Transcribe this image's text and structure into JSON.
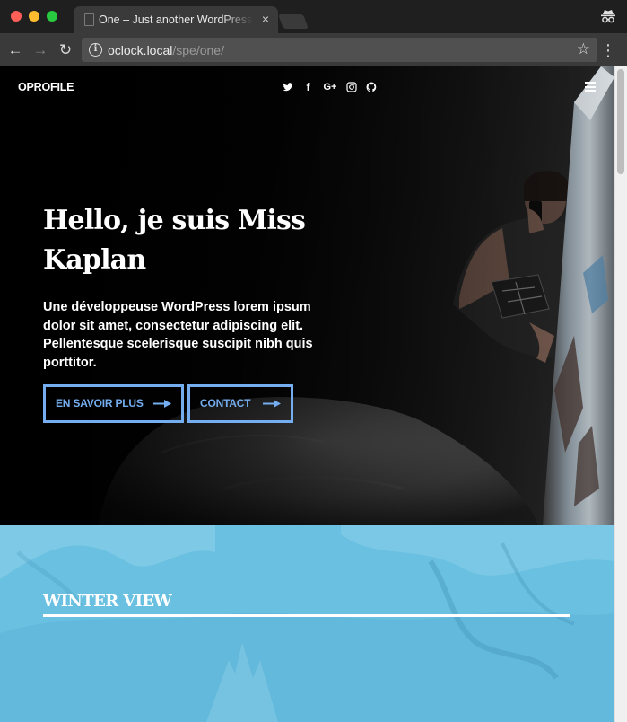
{
  "browser": {
    "tab_title": "One – Just another WordPress site",
    "tab_close": "×",
    "url_host": "oclock.local",
    "url_path": "/spe/one/",
    "info_glyph": "i",
    "back_glyph": "←",
    "forward_glyph": "→",
    "reload_glyph": "↻",
    "star_glyph": "☆",
    "menu_glyph": "⋮"
  },
  "site": {
    "logo": "OPROFILE",
    "socials": [
      {
        "name": "twitter-icon"
      },
      {
        "name": "facebook-icon",
        "glyph": "f"
      },
      {
        "name": "google-plus-icon",
        "glyph": "G+"
      },
      {
        "name": "instagram-icon"
      },
      {
        "name": "github-icon"
      }
    ]
  },
  "hero": {
    "title": "Hello, je suis Miss Kaplan",
    "text": "Une développeuse WordPress lorem ipsum dolor sit amet, consectetur adipiscing elit. Pellentesque scelerisque suscipit nibh quis porttitor.",
    "buttons": [
      {
        "label": "EN SAVOIR PLUS"
      },
      {
        "label": "CONTACT"
      }
    ]
  },
  "sections": {
    "winter": {
      "title": "WINTER VIEW"
    }
  },
  "colors": {
    "accent": "#74aef0",
    "winter_bg": "#69c0e0",
    "hero_bg": "#000000"
  }
}
